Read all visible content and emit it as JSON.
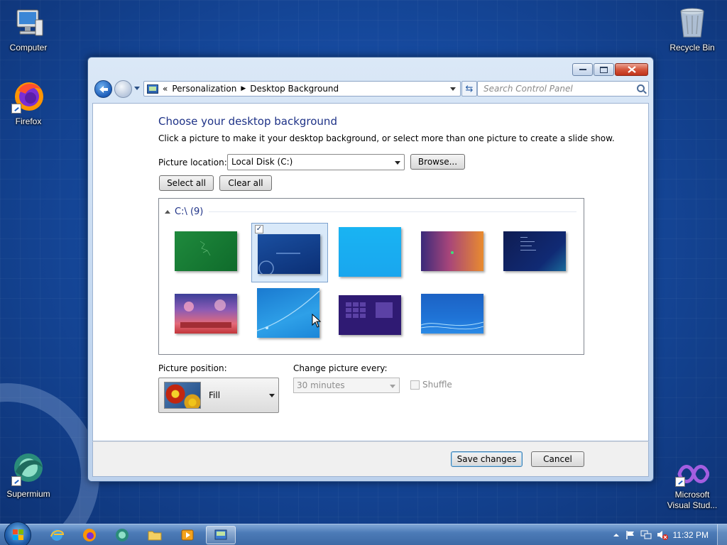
{
  "desktop": {
    "icons": [
      {
        "label": "Computer"
      },
      {
        "label": "Firefox"
      },
      {
        "label": "Supermium"
      },
      {
        "label": "Recycle Bin"
      },
      {
        "label": "Microsoft Visual Stud..."
      }
    ]
  },
  "window": {
    "address": {
      "prefix": "«",
      "crumbs": [
        "Personalization",
        "Desktop Background"
      ]
    },
    "search_placeholder": "Search Control Panel",
    "heading": "Choose your desktop background",
    "instructions": "Click a picture to make it your desktop background, or select more than one picture to create a slide show.",
    "location_label": "Picture location:",
    "location_value": "Local Disk (C:)",
    "browse_label": "Browse...",
    "select_all_label": "Select all",
    "clear_all_label": "Clear all",
    "group_label": "C:\\ (9)",
    "thumbnails": [
      {
        "name": "green",
        "selected": false
      },
      {
        "name": "dark-blue-windows",
        "selected": true
      },
      {
        "name": "cyan",
        "selected": false
      },
      {
        "name": "purple-orange",
        "selected": false
      },
      {
        "name": "navy-text",
        "selected": false
      },
      {
        "name": "pink-fantasy",
        "selected": false
      },
      {
        "name": "blue-swoosh",
        "selected": false
      },
      {
        "name": "purple-grid",
        "selected": false
      },
      {
        "name": "blue-waves",
        "selected": false
      }
    ],
    "checkmark": "✓",
    "position_label": "Picture position:",
    "position_value": "Fill",
    "change_label": "Change picture every:",
    "change_value": "30 minutes",
    "shuffle_label": "Shuffle",
    "save_label": "Save changes",
    "cancel_label": "Cancel"
  },
  "taskbar": {
    "clock": "11:32 PM"
  },
  "colors": {
    "heading": "#1e3287",
    "desktop": "#1a54ad",
    "selection": "#d9e9f9"
  }
}
